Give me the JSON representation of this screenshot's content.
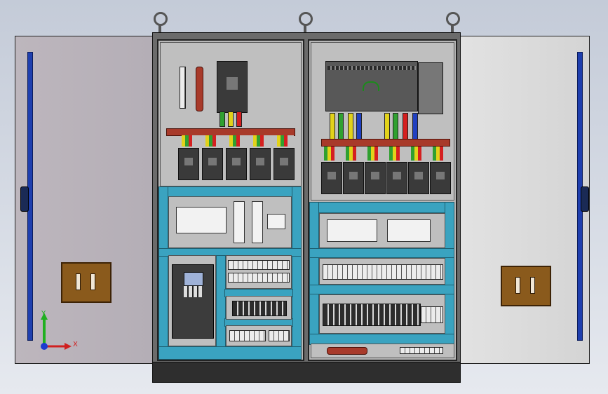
{
  "axis_triad": {
    "x_label": "X",
    "y_label": "Y"
  },
  "colors": {
    "cabinet_body": "#6b6b6b",
    "mounting_plate": "#bfbfbf",
    "wire_duct": "#3aa3c0",
    "busbar": "#a83a2a",
    "door_handle": "#1f3fae",
    "door_pocket": "#8a5a1c",
    "wire_red": "#d42020",
    "wire_yellow": "#e2d21a",
    "wire_green": "#30a030",
    "wire_blue": "#2040c0"
  }
}
